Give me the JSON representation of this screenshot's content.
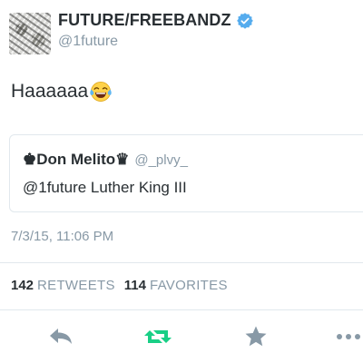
{
  "tweet": {
    "author": {
      "display_name": "FUTURE/FREEBANDZ",
      "handle": "@1future",
      "verified": true
    },
    "text": "Haaaaaa",
    "emoji": "face-with-tears-of-joy",
    "quoted": {
      "display_name": "♚Don Melito♛",
      "handle": "@_plvy_",
      "text": "@1future Luther King III"
    },
    "timestamp": "7/3/15, 11:06 PM",
    "stats": {
      "retweets_count": "142",
      "retweets_label": "RETWEETS",
      "favorites_count": "114",
      "favorites_label": "FAVORITES"
    },
    "actions": {
      "reply_icon": "reply-icon",
      "retweet_icon": "retweet-icon",
      "favorite_icon": "star-icon",
      "more_icon": "more-icon"
    }
  },
  "colors": {
    "text": "#292f33",
    "secondary": "#8899a6",
    "verified": "#55acee",
    "retweet_active": "#19cf86",
    "divider": "#e1e8ed"
  }
}
